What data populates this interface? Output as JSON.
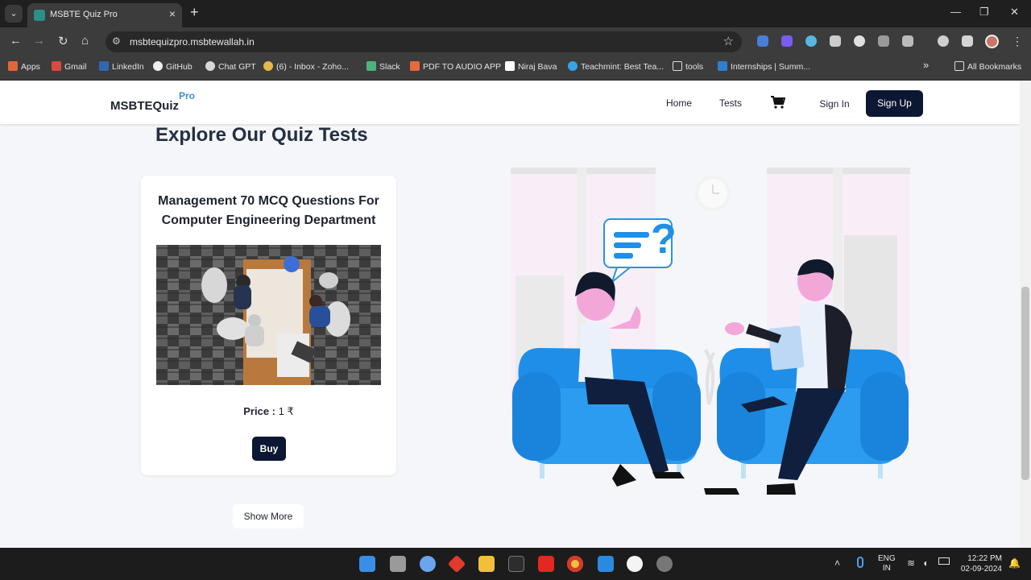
{
  "browser": {
    "tab_title": "MSBTE Quiz Pro",
    "url": "msbtequizpro.msbtewallah.in",
    "bookmarks": [
      "Apps",
      "Gmail",
      "LinkedIn",
      "GitHub",
      "Chat GPT",
      "(6) - Inbox - Zoho...",
      "Slack",
      "PDF TO AUDIO APP",
      "Niraj Bava",
      "Teachmint: Best Tea...",
      "tools",
      "Internships | Summ..."
    ],
    "all_bookmarks": "All Bookmarks",
    "overflow": "»"
  },
  "site": {
    "logo_main": "MSBTEQuiz",
    "logo_sup": "Pro",
    "nav": {
      "home": "Home",
      "tests": "Tests"
    },
    "sign_in": "Sign In",
    "sign_up": "Sign Up"
  },
  "main": {
    "heading": "Explore Our Quiz Tests",
    "card": {
      "title": "Management 70 MCQ Questions For Computer Engineering Department",
      "price_label": "Price :",
      "price_value": "1 ₹",
      "buy": "Buy"
    },
    "show_more": "Show More"
  },
  "taskbar": {
    "lang": "ENG",
    "region": "IN",
    "time": "12:22 PM",
    "date": "02-09-2024"
  },
  "colors": {
    "primary": "#0b1733",
    "accent": "#3d8bd9",
    "sofa": "#1f8fe8"
  }
}
